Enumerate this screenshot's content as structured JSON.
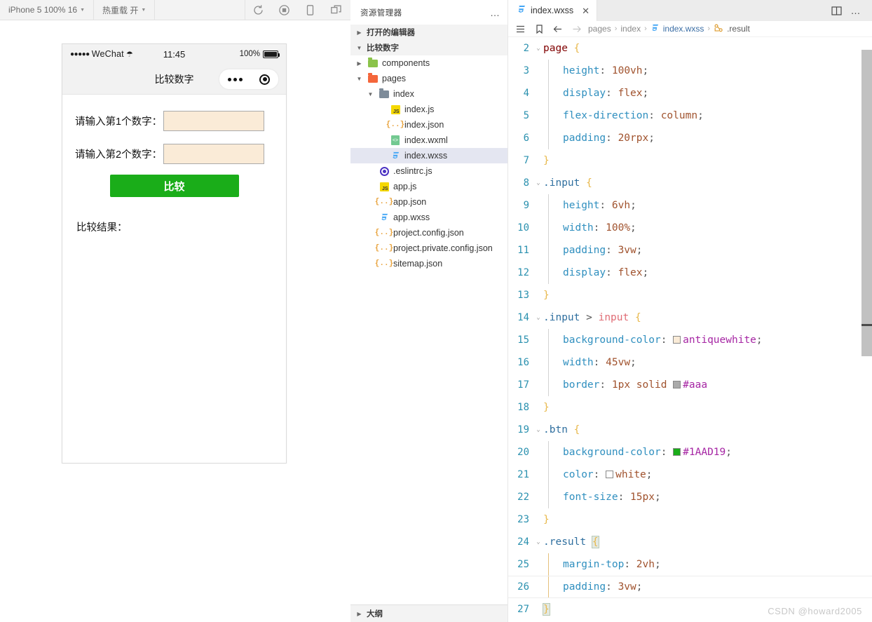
{
  "simulator": {
    "toolbar": {
      "device_label": "iPhone 5 100% 16",
      "hotreload_label": "热重载 开",
      "icons": [
        "refresh-icon",
        "record-icon",
        "device-icon",
        "detach-icon"
      ]
    },
    "phone": {
      "status": {
        "carrier": "WeChat",
        "signal_dots": "●●●●●",
        "time": "11:45",
        "battery": "100%"
      },
      "nav_title": "比较数字",
      "form": {
        "label1": "请输入第1个数字：",
        "label2": "请输入第2个数字：",
        "input1_value": "",
        "input2_value": "",
        "input_placeholder": "",
        "button_label": "比较",
        "result_label": "比较结果："
      }
    }
  },
  "explorer": {
    "title": "资源管理器",
    "more_label": "…",
    "sections": [
      {
        "label": "打开的编辑器",
        "expanded": false
      },
      {
        "label": "比较数字",
        "expanded": true
      }
    ],
    "tree": [
      {
        "label": "components",
        "icon": "folder-green-icon",
        "depth": 1,
        "type": "folder",
        "expanded": false,
        "selected": false
      },
      {
        "label": "pages",
        "icon": "folder-red-icon",
        "depth": 1,
        "type": "folder",
        "expanded": true,
        "selected": false
      },
      {
        "label": "index",
        "icon": "folder-gray-icon",
        "depth": 2,
        "type": "folder",
        "expanded": true,
        "selected": false
      },
      {
        "label": "index.js",
        "icon": "js-icon",
        "depth": 3,
        "type": "file",
        "selected": false
      },
      {
        "label": "index.json",
        "icon": "json-icon",
        "depth": 3,
        "type": "file",
        "selected": false
      },
      {
        "label": "index.wxml",
        "icon": "wxml-icon",
        "depth": 3,
        "type": "file",
        "selected": false
      },
      {
        "label": "index.wxss",
        "icon": "wxss-icon",
        "depth": 3,
        "type": "file",
        "selected": true
      },
      {
        "label": ".eslintrc.js",
        "icon": "eslint-icon",
        "depth": 2,
        "type": "file",
        "selected": false
      },
      {
        "label": "app.js",
        "icon": "js-icon",
        "depth": 2,
        "type": "file",
        "selected": false
      },
      {
        "label": "app.json",
        "icon": "json-icon",
        "depth": 2,
        "type": "file",
        "selected": false
      },
      {
        "label": "app.wxss",
        "icon": "wxss-icon",
        "depth": 2,
        "type": "file",
        "selected": false
      },
      {
        "label": "project.config.json",
        "icon": "json-icon",
        "depth": 2,
        "type": "file",
        "selected": false
      },
      {
        "label": "project.private.config.json",
        "icon": "json-icon",
        "depth": 2,
        "type": "file",
        "selected": false
      },
      {
        "label": "sitemap.json",
        "icon": "json-icon",
        "depth": 2,
        "type": "file",
        "selected": false
      }
    ],
    "outline_label": "大纲"
  },
  "editor": {
    "tab": {
      "label": "index.wxss",
      "icon": "wxss-icon",
      "close_label": "✕"
    },
    "actions": [
      "split-editor-icon",
      "more-actions-icon"
    ],
    "breadcrumb": {
      "icons": [
        "outline-list-icon",
        "bookmark-icon",
        "back-arrow-icon",
        "forward-arrow-icon"
      ],
      "items": [
        "pages",
        "index",
        "index.wxss",
        ".result"
      ],
      "separator": "›"
    },
    "lines": [
      {
        "n": 2,
        "fold": "v",
        "indent": 0,
        "tokens": [
          {
            "t": "sel",
            "v": "page"
          },
          {
            "t": "sp",
            "v": " "
          },
          {
            "t": "brace",
            "v": "{"
          }
        ]
      },
      {
        "n": 3,
        "fold": "",
        "indent": 1,
        "tokens": [
          {
            "t": "prop",
            "v": "height"
          },
          {
            "t": "punc",
            "v": ":"
          },
          {
            "t": "sp",
            "v": " "
          },
          {
            "t": "val",
            "v": "100vh"
          },
          {
            "t": "punc",
            "v": ";"
          }
        ]
      },
      {
        "n": 4,
        "fold": "",
        "indent": 1,
        "tokens": [
          {
            "t": "prop",
            "v": "display"
          },
          {
            "t": "punc",
            "v": ":"
          },
          {
            "t": "sp",
            "v": " "
          },
          {
            "t": "val",
            "v": "flex"
          },
          {
            "t": "punc",
            "v": ";"
          }
        ]
      },
      {
        "n": 5,
        "fold": "",
        "indent": 1,
        "tokens": [
          {
            "t": "prop",
            "v": "flex-direction"
          },
          {
            "t": "punc",
            "v": ":"
          },
          {
            "t": "sp",
            "v": " "
          },
          {
            "t": "val",
            "v": "column"
          },
          {
            "t": "punc",
            "v": ";"
          }
        ]
      },
      {
        "n": 6,
        "fold": "",
        "indent": 1,
        "tokens": [
          {
            "t": "prop",
            "v": "padding"
          },
          {
            "t": "punc",
            "v": ":"
          },
          {
            "t": "sp",
            "v": " "
          },
          {
            "t": "val",
            "v": "20rpx"
          },
          {
            "t": "punc",
            "v": ";"
          }
        ]
      },
      {
        "n": 7,
        "fold": "",
        "indent": 0,
        "tokens": [
          {
            "t": "brace",
            "v": "}"
          }
        ]
      },
      {
        "n": 8,
        "fold": "v",
        "indent": 0,
        "tokens": [
          {
            "t": "cls",
            "v": ".input"
          },
          {
            "t": "sp",
            "v": " "
          },
          {
            "t": "brace",
            "v": "{"
          }
        ]
      },
      {
        "n": 9,
        "fold": "",
        "indent": 1,
        "tokens": [
          {
            "t": "prop",
            "v": "height"
          },
          {
            "t": "punc",
            "v": ":"
          },
          {
            "t": "sp",
            "v": " "
          },
          {
            "t": "val",
            "v": "6vh"
          },
          {
            "t": "punc",
            "v": ";"
          }
        ]
      },
      {
        "n": 10,
        "fold": "",
        "indent": 1,
        "tokens": [
          {
            "t": "prop",
            "v": "width"
          },
          {
            "t": "punc",
            "v": ":"
          },
          {
            "t": "sp",
            "v": " "
          },
          {
            "t": "val",
            "v": "100%"
          },
          {
            "t": "punc",
            "v": ";"
          }
        ]
      },
      {
        "n": 11,
        "fold": "",
        "indent": 1,
        "tokens": [
          {
            "t": "prop",
            "v": "padding"
          },
          {
            "t": "punc",
            "v": ":"
          },
          {
            "t": "sp",
            "v": " "
          },
          {
            "t": "val",
            "v": "3vw"
          },
          {
            "t": "punc",
            "v": ";"
          }
        ]
      },
      {
        "n": 12,
        "fold": "",
        "indent": 1,
        "tokens": [
          {
            "t": "prop",
            "v": "display"
          },
          {
            "t": "punc",
            "v": ":"
          },
          {
            "t": "sp",
            "v": " "
          },
          {
            "t": "val",
            "v": "flex"
          },
          {
            "t": "punc",
            "v": ";"
          }
        ]
      },
      {
        "n": 13,
        "fold": "",
        "indent": 0,
        "tokens": [
          {
            "t": "brace",
            "v": "}"
          }
        ]
      },
      {
        "n": 14,
        "fold": "v",
        "indent": 0,
        "tokens": [
          {
            "t": "cls",
            "v": ".input"
          },
          {
            "t": "sp",
            "v": " "
          },
          {
            "t": "punc",
            "v": ">"
          },
          {
            "t": "sp",
            "v": " "
          },
          {
            "t": "tag",
            "v": "input"
          },
          {
            "t": "sp",
            "v": " "
          },
          {
            "t": "brace",
            "v": "{"
          }
        ]
      },
      {
        "n": 15,
        "fold": "",
        "indent": 1,
        "tokens": [
          {
            "t": "prop",
            "v": "background-color"
          },
          {
            "t": "punc",
            "v": ":"
          },
          {
            "t": "sp",
            "v": " "
          },
          {
            "t": "swatch",
            "v": "#faebd7"
          },
          {
            "t": "hex",
            "v": "antiquewhite"
          },
          {
            "t": "punc",
            "v": ";"
          }
        ]
      },
      {
        "n": 16,
        "fold": "",
        "indent": 1,
        "tokens": [
          {
            "t": "prop",
            "v": "width"
          },
          {
            "t": "punc",
            "v": ":"
          },
          {
            "t": "sp",
            "v": " "
          },
          {
            "t": "val",
            "v": "45vw"
          },
          {
            "t": "punc",
            "v": ";"
          }
        ]
      },
      {
        "n": 17,
        "fold": "",
        "indent": 1,
        "tokens": [
          {
            "t": "prop",
            "v": "border"
          },
          {
            "t": "punc",
            "v": ":"
          },
          {
            "t": "sp",
            "v": " "
          },
          {
            "t": "val",
            "v": "1px solid"
          },
          {
            "t": "sp",
            "v": " "
          },
          {
            "t": "swatch",
            "v": "#aaaaaa"
          },
          {
            "t": "hex",
            "v": "#aaa"
          }
        ]
      },
      {
        "n": 18,
        "fold": "",
        "indent": 0,
        "tokens": [
          {
            "t": "brace",
            "v": "}"
          }
        ]
      },
      {
        "n": 19,
        "fold": "v",
        "indent": 0,
        "tokens": [
          {
            "t": "cls",
            "v": ".btn"
          },
          {
            "t": "sp",
            "v": " "
          },
          {
            "t": "brace",
            "v": "{"
          }
        ]
      },
      {
        "n": 20,
        "fold": "",
        "indent": 1,
        "tokens": [
          {
            "t": "prop",
            "v": "background-color"
          },
          {
            "t": "punc",
            "v": ":"
          },
          {
            "t": "sp",
            "v": " "
          },
          {
            "t": "swatch",
            "v": "#1AAD19"
          },
          {
            "t": "hex",
            "v": "#1AAD19"
          },
          {
            "t": "punc",
            "v": ";"
          }
        ]
      },
      {
        "n": 21,
        "fold": "",
        "indent": 1,
        "tokens": [
          {
            "t": "prop",
            "v": "color"
          },
          {
            "t": "punc",
            "v": ":"
          },
          {
            "t": "sp",
            "v": " "
          },
          {
            "t": "swatch",
            "v": "#ffffff"
          },
          {
            "t": "val",
            "v": "white"
          },
          {
            "t": "punc",
            "v": ";"
          }
        ]
      },
      {
        "n": 22,
        "fold": "",
        "indent": 1,
        "tokens": [
          {
            "t": "prop",
            "v": "font-size"
          },
          {
            "t": "punc",
            "v": ":"
          },
          {
            "t": "sp",
            "v": " "
          },
          {
            "t": "val",
            "v": "15px"
          },
          {
            "t": "punc",
            "v": ";"
          }
        ]
      },
      {
        "n": 23,
        "fold": "",
        "indent": 0,
        "tokens": [
          {
            "t": "brace",
            "v": "}"
          }
        ]
      },
      {
        "n": 24,
        "fold": "v",
        "indent": 0,
        "tokens": [
          {
            "t": "cls",
            "v": ".result"
          },
          {
            "t": "sp",
            "v": " "
          },
          {
            "t": "brace-hl",
            "v": "{"
          }
        ]
      },
      {
        "n": 25,
        "fold": "",
        "indent": 1,
        "tokens": [
          {
            "t": "prop",
            "v": "margin-top"
          },
          {
            "t": "punc",
            "v": ":"
          },
          {
            "t": "sp",
            "v": " "
          },
          {
            "t": "val",
            "v": "2vh"
          },
          {
            "t": "punc",
            "v": ";"
          }
        ]
      },
      {
        "n": 26,
        "fold": "",
        "indent": 1,
        "tokens": [
          {
            "t": "prop",
            "v": "padding"
          },
          {
            "t": "punc",
            "v": ":"
          },
          {
            "t": "sp",
            "v": " "
          },
          {
            "t": "val",
            "v": "3vw"
          },
          {
            "t": "punc",
            "v": ";"
          }
        ]
      },
      {
        "n": 27,
        "fold": "",
        "indent": 0,
        "tokens": [
          {
            "t": "brace-hl",
            "v": "}"
          }
        ]
      }
    ],
    "watermark": "CSDN @howard2005"
  },
  "colors": {
    "wechat_green": "#1AAD19",
    "antiquewhite": "#FAEBD7",
    "input_border": "#aaaaaa",
    "selection": "#e4e6f1",
    "accent_blue": "#3b6ea5"
  }
}
